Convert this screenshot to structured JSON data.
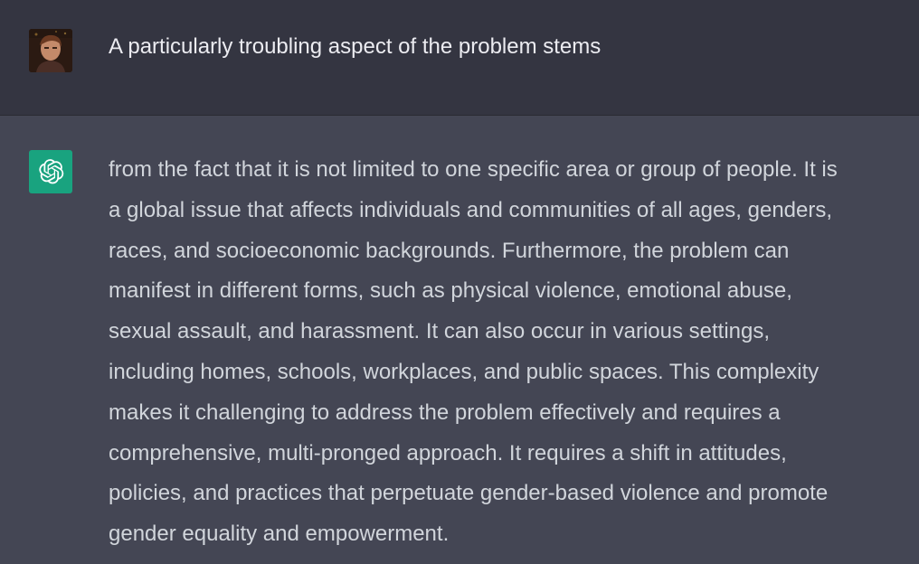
{
  "conversation": {
    "user_message": {
      "avatar": "user-avatar-photo",
      "text": "A particularly troubling aspect of the problem stems"
    },
    "assistant_message": {
      "icon": "openai-logo-icon",
      "icon_bg": "#19a37f",
      "lines": [
        "from the fact that it is not limited to one specific area or group of people. It is",
        "a global issue that affects individuals and communities of all ages, genders,",
        "races, and socioeconomic backgrounds. Furthermore, the problem can",
        "manifest in different forms, such as physical violence, emotional abuse,",
        "sexual assault, and harassment. It can also occur in various settings,",
        "including homes, schools, workplaces, and public spaces. This complexity",
        "makes it challenging to address the problem effectively and requires a",
        "comprehensive, multi-pronged approach. It requires a shift in attitudes,",
        "policies, and practices that perpetuate gender-based violence and promote",
        "gender equality and empowerment."
      ]
    }
  },
  "colors": {
    "user_row_bg": "#343541",
    "assistant_row_bg": "#444654",
    "user_text": "#ececf1",
    "assistant_text": "#d1d5db"
  }
}
